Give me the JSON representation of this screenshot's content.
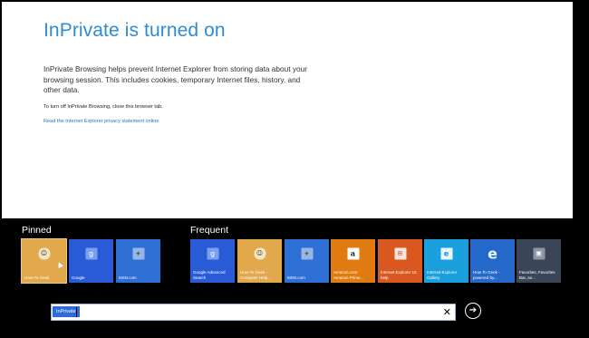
{
  "page": {
    "heading": "InPrivate is turned on",
    "description": "InPrivate Browsing helps prevent Internet Explorer from storing data about your browsing session. This includes cookies, temporary Internet files, history, and other data.",
    "turn_off_text": "To turn off InPrivate Browsing, close this browser tab.",
    "privacy_link": "Read the Internet Explorer privacy statement online"
  },
  "pinned": {
    "title": "Pinned",
    "tiles": [
      {
        "label": "How-To Geek",
        "icon": "howtogeek-icon",
        "color": "#e2a84c",
        "glyph": "☺"
      },
      {
        "label": "Google",
        "icon": "google-icon",
        "color": "#2a5bd7",
        "glyph": "g"
      },
      {
        "label": "MSN.com",
        "icon": "msn-icon",
        "color": "#2e6fd6",
        "glyph": "✦"
      }
    ]
  },
  "frequent": {
    "title": "Frequent",
    "tiles": [
      {
        "label": "Google Advanced Search",
        "icon": "google-icon",
        "color": "#2a5bd7",
        "glyph": "g"
      },
      {
        "label": "How-To Geek - Computer Help...",
        "icon": "howtogeek-icon",
        "color": "#e2a84c",
        "glyph": "☺"
      },
      {
        "label": "MSN.com",
        "icon": "msn-icon",
        "color": "#2e6fd6",
        "glyph": "✦"
      },
      {
        "label": "Amazon.com: Amazon Prime...",
        "icon": "amazon-icon",
        "color": "#e07b12",
        "glyph": "a"
      },
      {
        "label": "Internet Explorer 10 help",
        "icon": "windows-icon",
        "color": "#d85820",
        "glyph": "⊞"
      },
      {
        "label": "Internet Explorer Gallery",
        "icon": "ie-icon",
        "color": "#1aa0dc",
        "glyph": "e"
      },
      {
        "label": "How To Geek - powered by...",
        "icon": "ie-icon",
        "color": "#2469c9",
        "glyph": "e"
      },
      {
        "label": "Favorites, Favorites Bar, an...",
        "icon": "favorites-icon",
        "color": "#3a4657",
        "glyph": "▣"
      }
    ]
  },
  "address_bar": {
    "badge": "InPrivate",
    "value": "",
    "clear_glyph": "✕",
    "go_glyph": "➔"
  },
  "colors": {
    "heading": "#2e8bd4",
    "link": "#1d76c2",
    "badge": "#2d6bd6"
  }
}
